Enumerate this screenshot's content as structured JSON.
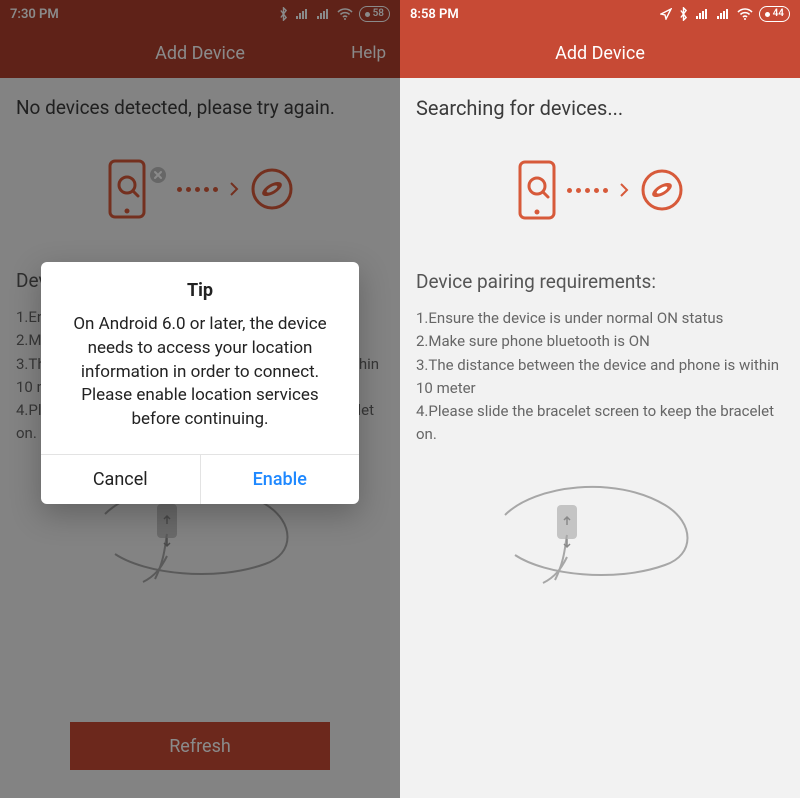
{
  "left": {
    "status_bar": {
      "time": "7:30 PM",
      "battery": "58"
    },
    "header": {
      "title": "Add Device",
      "help": "Help"
    },
    "status_text": "No devices detected, please try again.",
    "requirements_title": "Device pairing requirements:",
    "requirements": [
      "1.Ensure the device is under normal ON status",
      "2.Make sure phone bluetooth is ON",
      "3.The distance between the device and phone is within 10 meter",
      "4.Please slide the bracelet screen to keep the bracelet on."
    ],
    "refresh_label": "Refresh",
    "dialog": {
      "title": "Tip",
      "body": "On Android 6.0 or later, the device needs to access your location information in order to connect. Please enable location services before continuing.",
      "cancel": "Cancel",
      "enable": "Enable"
    }
  },
  "right": {
    "status_bar": {
      "time": "8:58 PM",
      "battery": "44"
    },
    "header": {
      "title": "Add Device"
    },
    "status_text": "Searching for devices...",
    "requirements_title": "Device pairing requirements:",
    "requirements": [
      "1.Ensure the device is under normal ON status",
      "2.Make sure phone bluetooth is ON",
      "3.The distance between the device and phone is within 10 meter",
      "4.Please slide the bracelet screen to keep the bracelet on."
    ]
  },
  "colors": {
    "accent": "#c74a35"
  }
}
